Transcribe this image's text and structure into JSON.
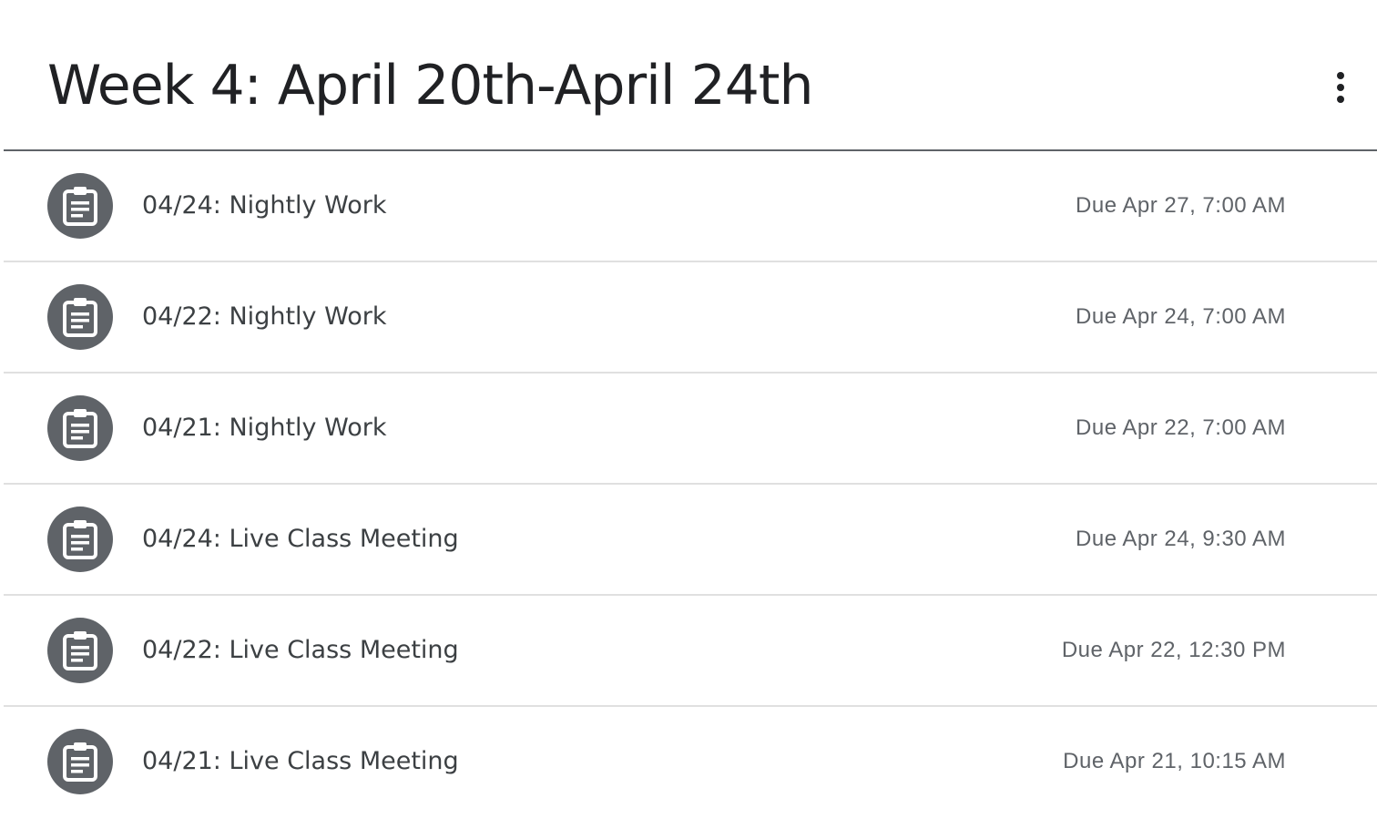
{
  "topic": {
    "title": "Week 4: April 20th-April 24th",
    "menu_icon": "more-vert-icon"
  },
  "colors": {
    "icon_background": "#5f6368",
    "title_text": "#202124",
    "item_text": "#3c4043",
    "due_text": "#5f6368",
    "divider": "#e0e0e0",
    "header_divider": "#5f6368"
  },
  "assignments": [
    {
      "icon": "assignment-icon",
      "title": "04/24: Nightly Work",
      "due": "Due Apr 27, 7:00 AM"
    },
    {
      "icon": "assignment-icon",
      "title": "04/22: Nightly Work",
      "due": "Due Apr 24, 7:00 AM"
    },
    {
      "icon": "assignment-icon",
      "title": "04/21: Nightly Work",
      "due": "Due Apr 22, 7:00 AM"
    },
    {
      "icon": "assignment-icon",
      "title": "04/24: Live Class Meeting",
      "due": "Due Apr 24, 9:30 AM"
    },
    {
      "icon": "assignment-icon",
      "title": "04/22: Live Class Meeting",
      "due": "Due Apr 22, 12:30 PM"
    },
    {
      "icon": "assignment-icon",
      "title": "04/21: Live Class Meeting",
      "due": "Due Apr 21, 10:15 AM"
    }
  ]
}
